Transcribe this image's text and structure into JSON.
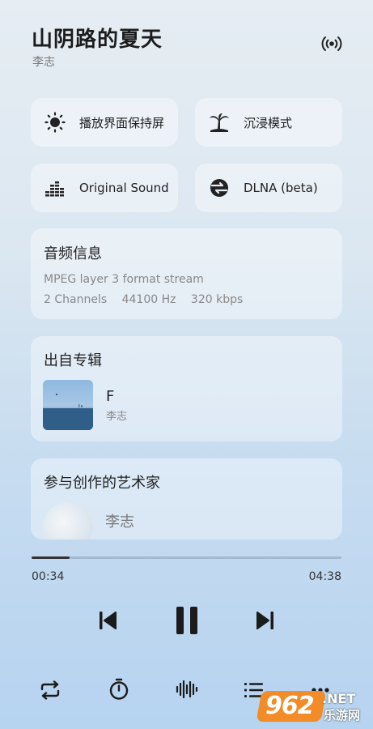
{
  "song": {
    "title": "山阴路的夏天",
    "artist": "李志"
  },
  "actions": [
    {
      "label": "播放界面保持屏",
      "icon": "sun-icon"
    },
    {
      "label": "沉浸模式",
      "icon": "palm-tree-icon"
    },
    {
      "label": "Original Sound",
      "icon": "equalizer-icon"
    },
    {
      "label": "DLNA (beta)",
      "icon": "dlna-icon"
    }
  ],
  "audio_info": {
    "title": "音频信息",
    "format": "MPEG layer 3 format stream",
    "channels": "2 Channels",
    "sample_rate": "44100 Hz",
    "bitrate": "320 kbps"
  },
  "album": {
    "section_title": "出自专辑",
    "name": "F",
    "artist": "李志"
  },
  "artists_section": {
    "title": "参与创作的艺术家",
    "artist": "李志"
  },
  "playback": {
    "elapsed": "00:34",
    "total": "04:38",
    "progress": 0.122
  },
  "watermark": {
    "number": "962",
    "suffix": ".NET",
    "text": "乐游网"
  },
  "colors": {
    "accent": "#222222",
    "background_top": "#e6edf3",
    "background_bottom": "#b6d3f0",
    "watermark_orange": "#f28c28"
  }
}
